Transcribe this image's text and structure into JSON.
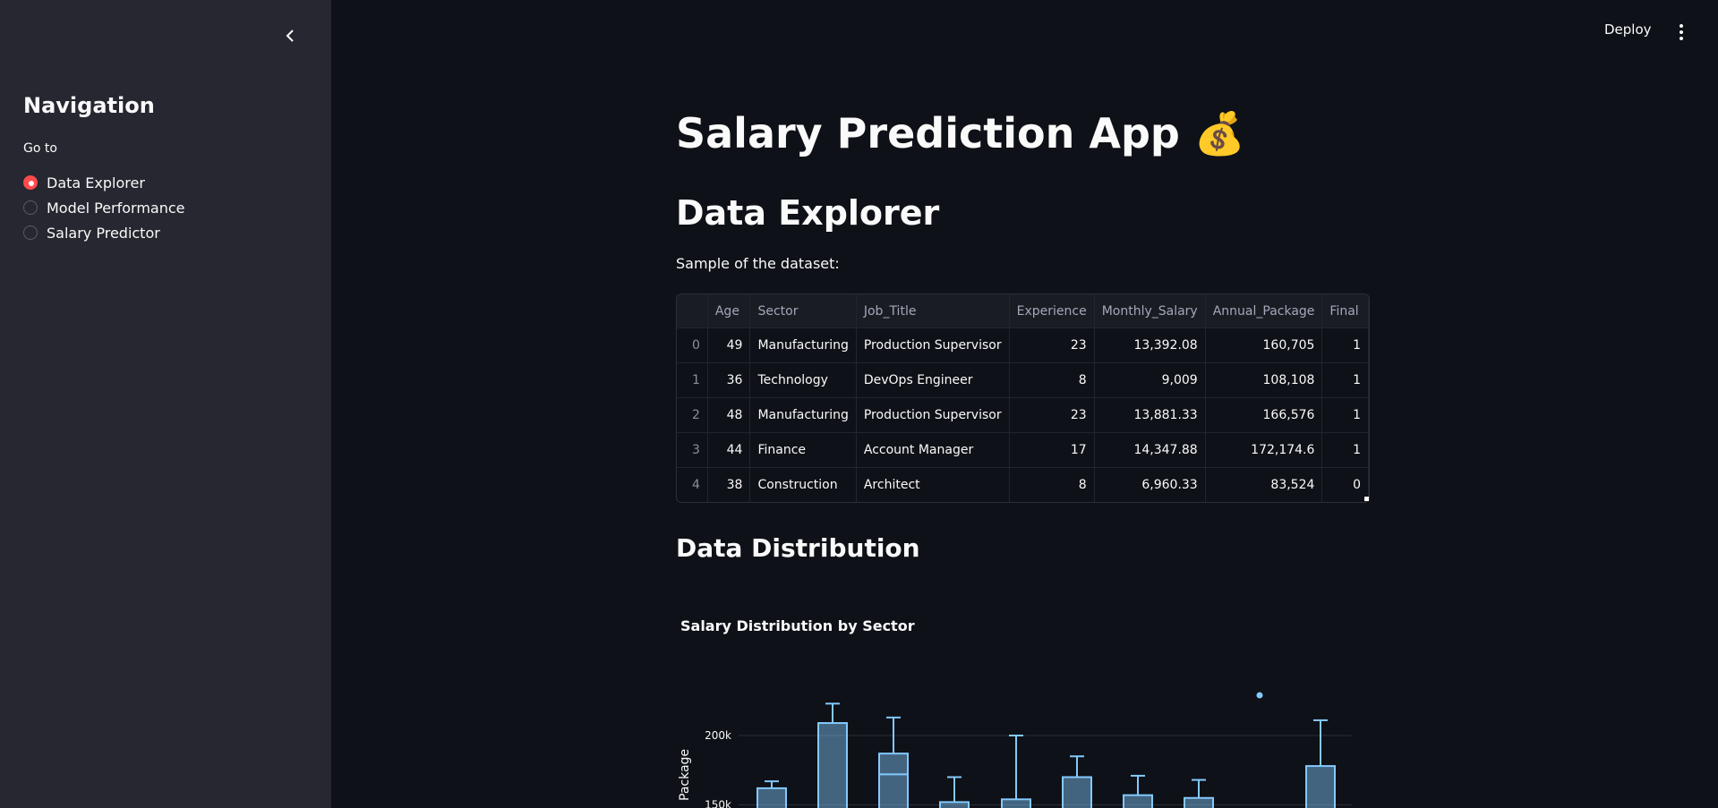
{
  "sidebar": {
    "title": "Navigation",
    "goto_label": "Go to",
    "options": [
      {
        "label": "Data Explorer",
        "selected": true
      },
      {
        "label": "Model Performance",
        "selected": false
      },
      {
        "label": "Salary Predictor",
        "selected": false
      }
    ]
  },
  "header": {
    "deploy_label": "Deploy"
  },
  "main": {
    "app_title": "Salary Prediction App 💰",
    "section_title": "Data Explorer",
    "sample_text": "Sample of the dataset:",
    "table": {
      "columns": [
        "",
        "Age",
        "Sector",
        "Job_Title",
        "Experience",
        "Monthly_Salary",
        "Annual_Package",
        "Final"
      ],
      "rows": [
        [
          "0",
          "49",
          "Manufacturing",
          "Production Supervisor",
          "23",
          "13,392.08",
          "160,705",
          "1"
        ],
        [
          "1",
          "36",
          "Technology",
          "DevOps Engineer",
          "8",
          "9,009",
          "108,108",
          "1"
        ],
        [
          "2",
          "48",
          "Manufacturing",
          "Production Supervisor",
          "23",
          "13,881.33",
          "166,576",
          "1"
        ],
        [
          "3",
          "44",
          "Finance",
          "Account Manager",
          "17",
          "14,347.88",
          "172,174.6",
          "1"
        ],
        [
          "4",
          "38",
          "Construction",
          "Architect",
          "8",
          "6,960.33",
          "83,524",
          "0"
        ]
      ]
    },
    "distribution_title": "Data Distribution"
  },
  "chart_data": {
    "type": "box",
    "title": "Salary Distribution by Sector",
    "xlabel": "",
    "ylabel": "Package",
    "y_ticks": [
      "200k",
      "150k"
    ],
    "y_tick_values": [
      200000,
      150000
    ],
    "ylim": [
      140000,
      230000
    ],
    "color": "#83c9ff",
    "outliers": [
      {
        "group": 9,
        "value": 229000
      }
    ],
    "boxes": [
      {
        "group": 0,
        "q3": 162000,
        "upper": 167000
      },
      {
        "group": 1,
        "q3": 209000,
        "upper": 223000
      },
      {
        "group": 2,
        "q3": 187000,
        "median": 172000,
        "upper": 213000
      },
      {
        "group": 3,
        "q3": 152000,
        "upper": 170000
      },
      {
        "group": 4,
        "q3": 154000,
        "upper": 200000
      },
      {
        "group": 5,
        "q3": 170000,
        "upper": 185000
      },
      {
        "group": 6,
        "q3": 157000,
        "upper": 171000
      },
      {
        "group": 7,
        "q3": 155000,
        "upper": 168000
      },
      {
        "group": 8,
        "q3": null,
        "upper": null
      },
      {
        "group": 9,
        "q3": 178000,
        "upper": 211000
      }
    ]
  }
}
